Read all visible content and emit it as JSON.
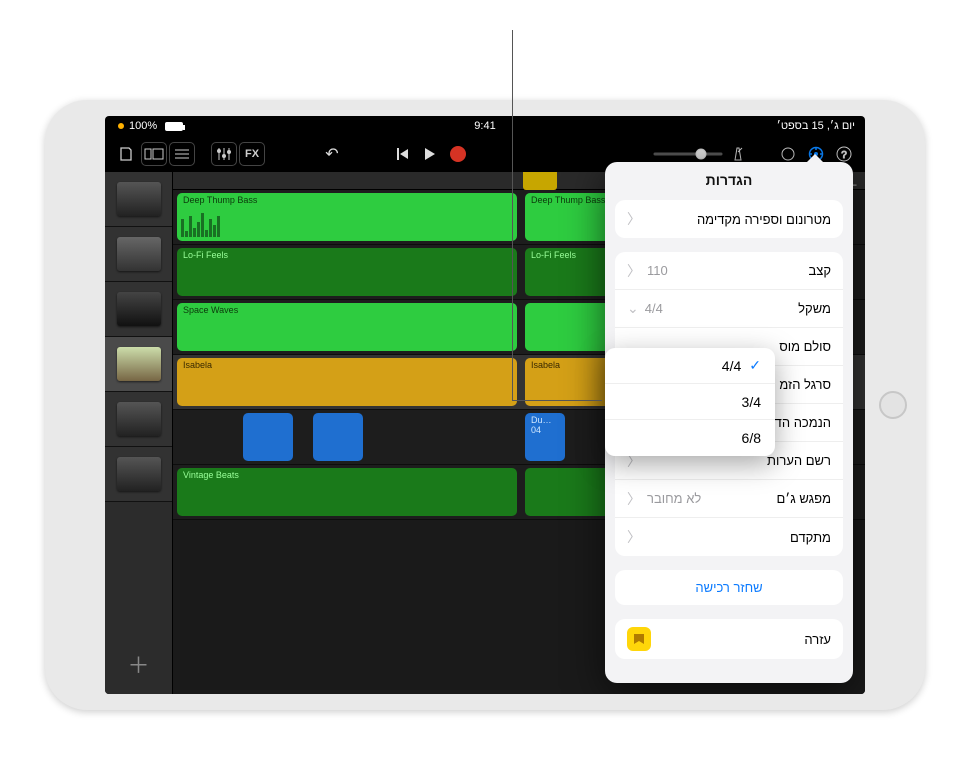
{
  "statusbar": {
    "time": "9:41",
    "date": "יום ג׳, 15 בספט׳",
    "battery_pct": "100%"
  },
  "toolbar": {
    "fx_label": "FX"
  },
  "tracks": [
    {
      "name": "Deep Thump Bass",
      "color": "green"
    },
    {
      "name": "Lo-Fi Feels",
      "color": "green"
    },
    {
      "name": "Space Waves",
      "color": "green"
    },
    {
      "name": "Isabela",
      "color": "yellow"
    },
    {
      "name": "Du…04",
      "color": "blue"
    },
    {
      "name": "Vintage Beats",
      "color": "green"
    }
  ],
  "popover": {
    "title": "הגדרות",
    "rows": {
      "metronome": "מטרונום וספירה מקדימה",
      "tempo_label": "קצב",
      "tempo_value": "110",
      "timesig_label": "משקל",
      "timesig_value": "4/4",
      "scale_label": "סולם מוס",
      "timeruler_label": "סרגל הזמ",
      "fadeout_label": "הנמכה הדרגתית",
      "notepad_label": "רשם הערות",
      "jam_label": "מפגש ג׳ם",
      "jam_value": "לא מחובר",
      "advanced_label": "מתקדם"
    },
    "restore": "שחזר רכישה",
    "help": "עזרה"
  },
  "ts_options": {
    "o44": "4/4",
    "o34": "3/4",
    "o68": "6/8"
  }
}
